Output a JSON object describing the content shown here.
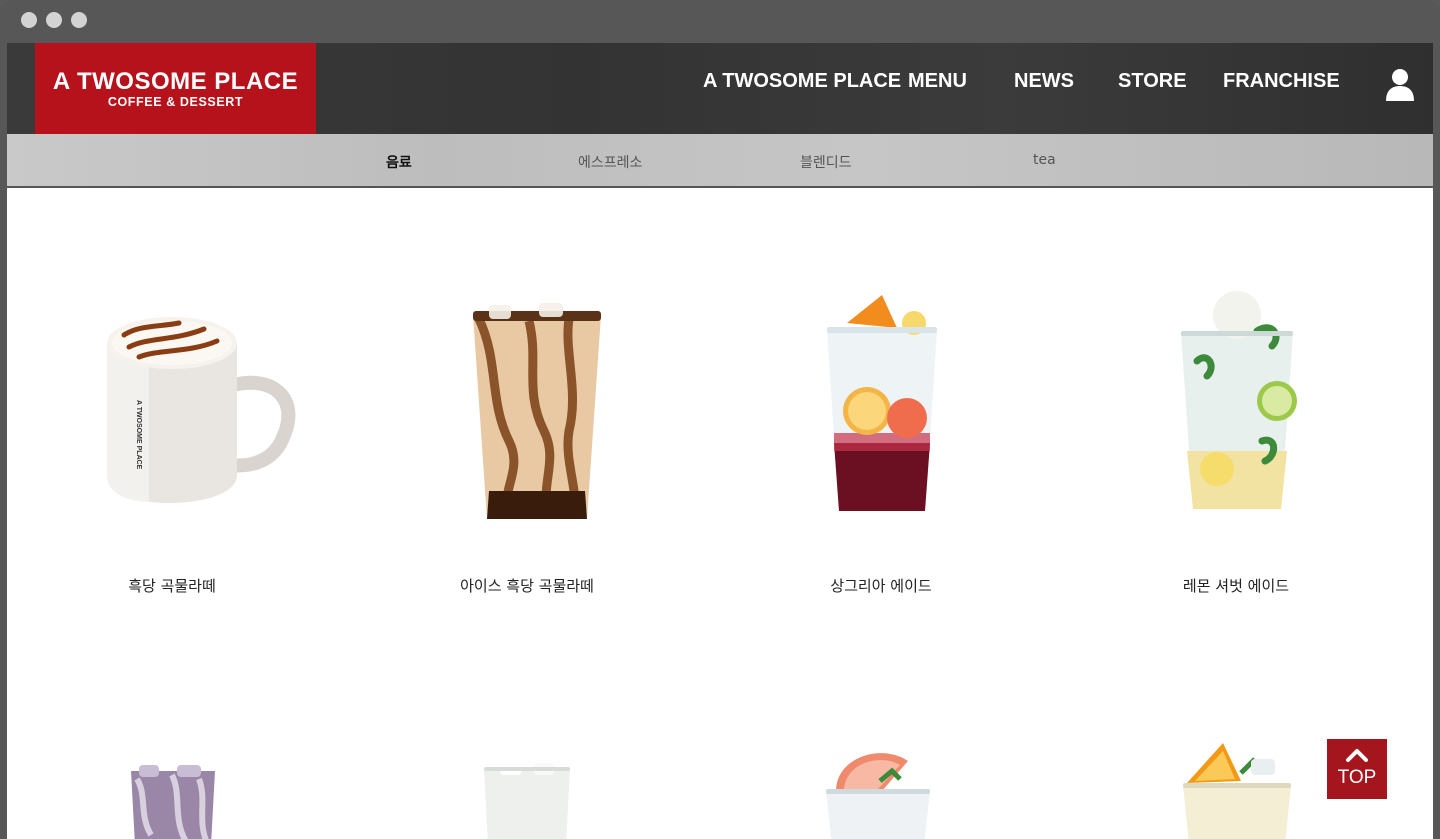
{
  "brand": {
    "name": "A TWOSOME PLACE",
    "tagline": "COFFEE & DESSERT",
    "color": "#b5121b"
  },
  "nav": {
    "items": [
      "A TWOSOME PLACE",
      "MENU",
      "NEWS",
      "STORE",
      "FRANCHISE"
    ],
    "user_icon": "user-icon"
  },
  "subnav": {
    "items": [
      "음료",
      "에스프레소",
      "블렌디드",
      "tea"
    ],
    "active": "음료"
  },
  "products": [
    {
      "name": "흑당 곡물라떼",
      "icon": "hot-latte-mug"
    },
    {
      "name": "아이스 흑당 곡물라떼",
      "icon": "iced-latte-cup"
    },
    {
      "name": "상그리아 에이드",
      "icon": "sangria-ade-cup"
    },
    {
      "name": "레몬 셔벗 에이드",
      "icon": "lemon-sherbet-ade-cup"
    },
    {
      "name": "",
      "icon": "purple-drink-cup"
    },
    {
      "name": "",
      "icon": "white-drink-cup"
    },
    {
      "name": "",
      "icon": "grapefruit-ade-cup"
    },
    {
      "name": "",
      "icon": "orange-ade-cup"
    }
  ],
  "top_button": {
    "label": "TOP",
    "icon": "chevron-up-icon"
  }
}
